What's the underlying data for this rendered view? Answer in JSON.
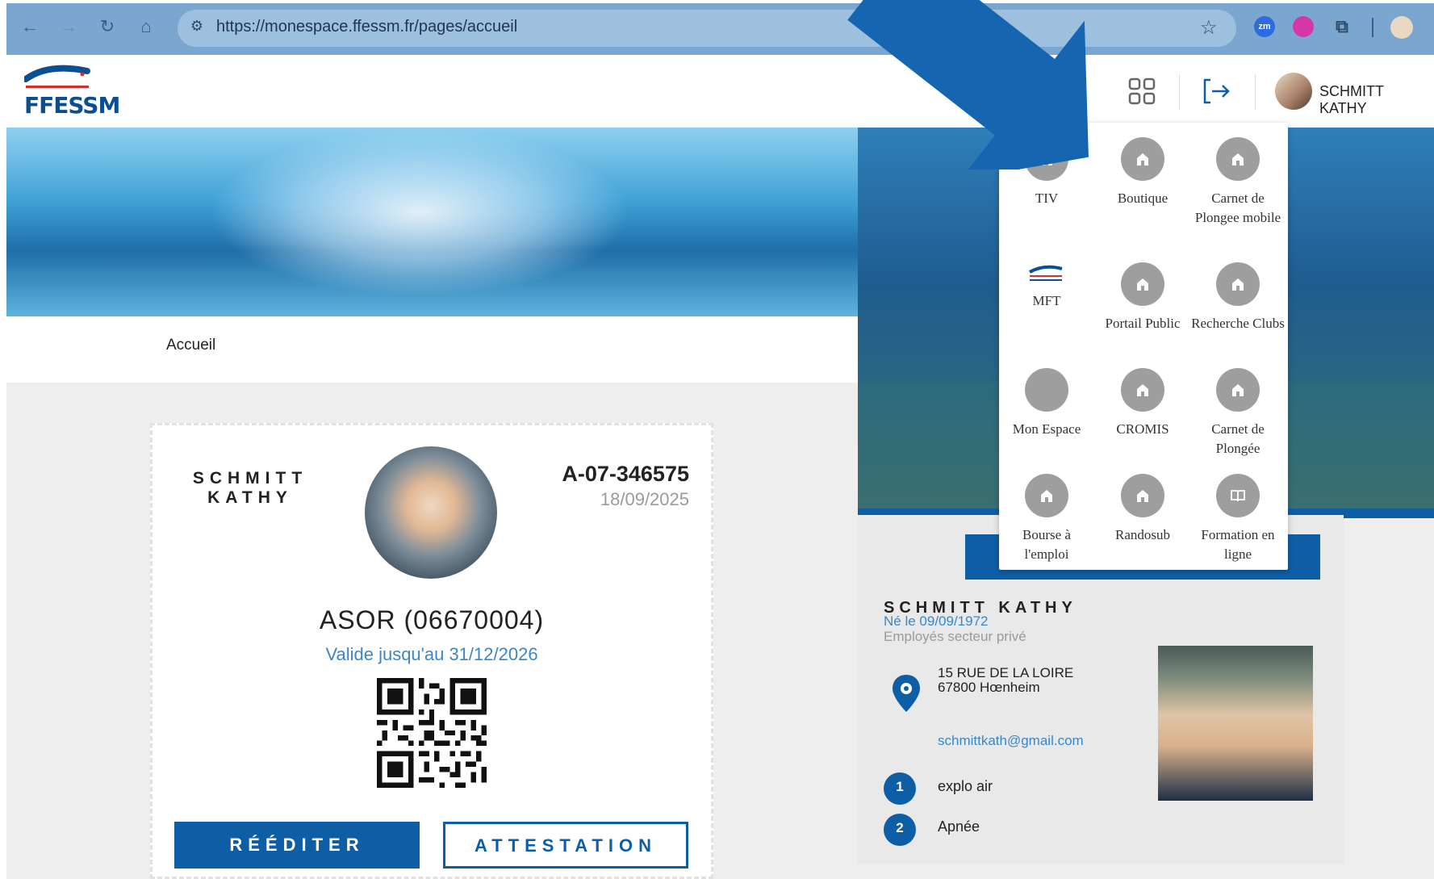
{
  "browser": {
    "url": "https://monespace.ffessm.fr/pages/accueil",
    "extensions": [
      "zm"
    ]
  },
  "header": {
    "logo_text": "FFESSM",
    "user_name": "SCHMITT KATHY"
  },
  "breadcrumb": "Accueil",
  "card": {
    "last_name": "SCHMITT",
    "first_name": "KATHY",
    "license_id": "A-07-346575",
    "date": "18/09/2025",
    "club": "ASOR (06670004)",
    "validity": "Valide jusqu'au 31/12/2026",
    "buttons": {
      "reedit": "RÉÉDITER",
      "attestation": "ATTESTATION"
    }
  },
  "profile": {
    "name": "SCHMITT KATHY",
    "born": "Né le 09/09/1972",
    "job": "Employés secteur privé",
    "address_line1": "15 RUE DE LA LOIRE",
    "address_line2": "67800 Hœnheim",
    "email": "schmittkath@gmail.com",
    "specialities": [
      {
        "num": "1",
        "label": "explo air"
      },
      {
        "num": "2",
        "label": "Apnée"
      }
    ]
  },
  "apps_menu": [
    {
      "label": "TIV",
      "icon": "home-icon"
    },
    {
      "label": "Boutique",
      "icon": "home-icon"
    },
    {
      "label": "Carnet de Plongee mobile",
      "icon": "home-icon"
    },
    {
      "label": "MFT",
      "icon": "mft-logo-icon"
    },
    {
      "label": "Portail Public",
      "icon": "home-icon"
    },
    {
      "label": "Recherche Clubs",
      "icon": "home-icon"
    },
    {
      "label": "Mon Espace",
      "icon": "blank-circle-icon"
    },
    {
      "label": "CROMIS",
      "icon": "home-icon"
    },
    {
      "label": "Carnet de Plongée",
      "icon": "home-icon"
    },
    {
      "label": "Bourse à l'emploi",
      "icon": "home-icon"
    },
    {
      "label": "Randosub",
      "icon": "home-icon"
    },
    {
      "label": "Formation en ligne",
      "icon": "book-icon"
    }
  ],
  "colors": {
    "brand_blue": "#0e5ea6",
    "link_blue": "#3a87c8",
    "annotation_arrow": "#1565b0"
  }
}
